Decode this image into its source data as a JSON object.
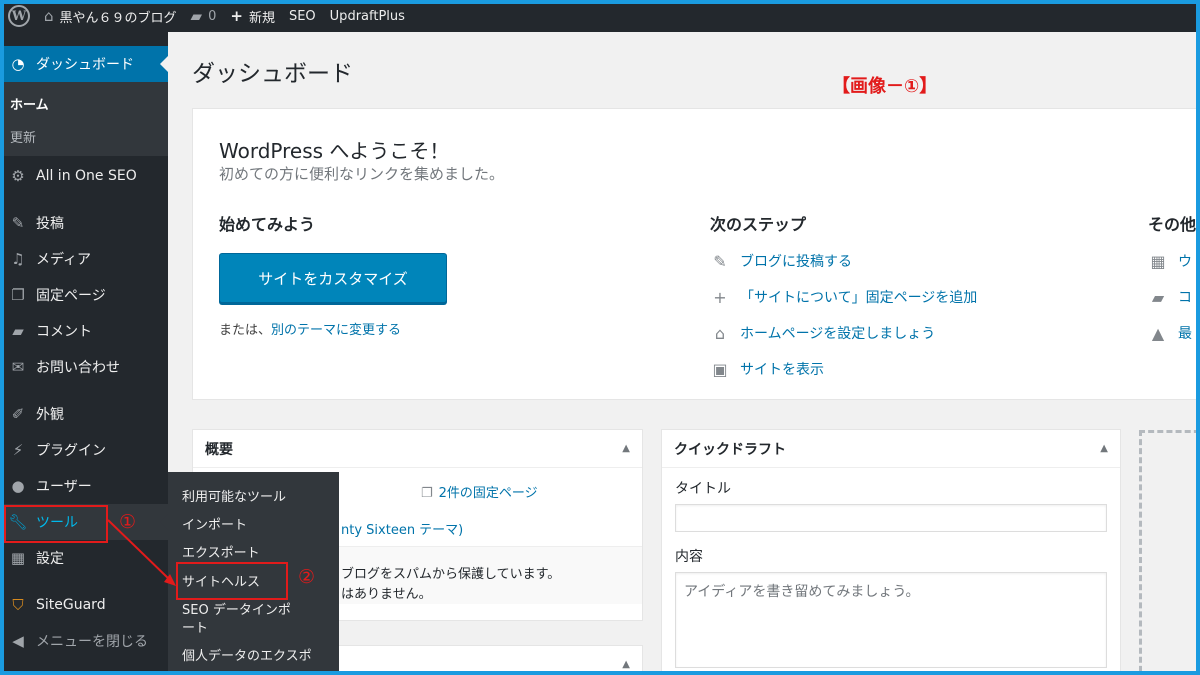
{
  "adminbar": {
    "site_name": "黒やん６９のブログ",
    "comments": "0",
    "new": "新規",
    "seo": "SEO",
    "updraft": "UpdraftPlus"
  },
  "sidebar": {
    "dashboard": "ダッシュボード",
    "home": "ホーム",
    "updates": "更新",
    "aioseo": "All in One SEO",
    "posts": "投稿",
    "media": "メディア",
    "pages": "固定ページ",
    "comments": "コメント",
    "contact": "お問い合わせ",
    "appearance": "外観",
    "plugins": "プラグイン",
    "users": "ユーザー",
    "tools": "ツール",
    "settings": "設定",
    "siteguard": "SiteGuard",
    "collapse": "メニューを閉じる"
  },
  "flyout": {
    "available_tools": "利用可能なツール",
    "import": "インポート",
    "export": "エクスポート",
    "site_health": "サイトヘルス",
    "seo_import": "SEO データインポート",
    "personal_data": "個人データのエクスポ"
  },
  "annotations": {
    "title": "【画像－①】",
    "num1": "①",
    "num2": "②"
  },
  "main": {
    "page_title": "ダッシュボード",
    "welcome_title": "WordPress へようこそ！",
    "welcome_about": "初めての方に便利なリンクを集めました。",
    "get_started": "始めてみよう",
    "customize_button": "サイトをカスタマイズ",
    "or_text": "または、",
    "change_theme_link": "別のテーマに変更する",
    "next_steps": "次のステップ",
    "step1": "ブログに投稿する",
    "step2": "「サイトについて」固定ページを追加",
    "step3": "ホームページを設定しましょう",
    "step4": "サイトを表示",
    "more_actions": "その他",
    "more1": "ウ",
    "more2": "コ",
    "more3": "最"
  },
  "glance": {
    "title": "概要",
    "pages_count": "2件の固定ページ",
    "theme_text": "nty Sixteen テーマ)",
    "spam_text": "ブログをスパムから保護しています。",
    "spam_text2": "はありません。"
  },
  "quickdraft": {
    "title": "クイックドラフト",
    "title_label": "タイトル",
    "content_label": "内容",
    "content_placeholder": "アイディアを書き留めてみましょう。"
  }
}
